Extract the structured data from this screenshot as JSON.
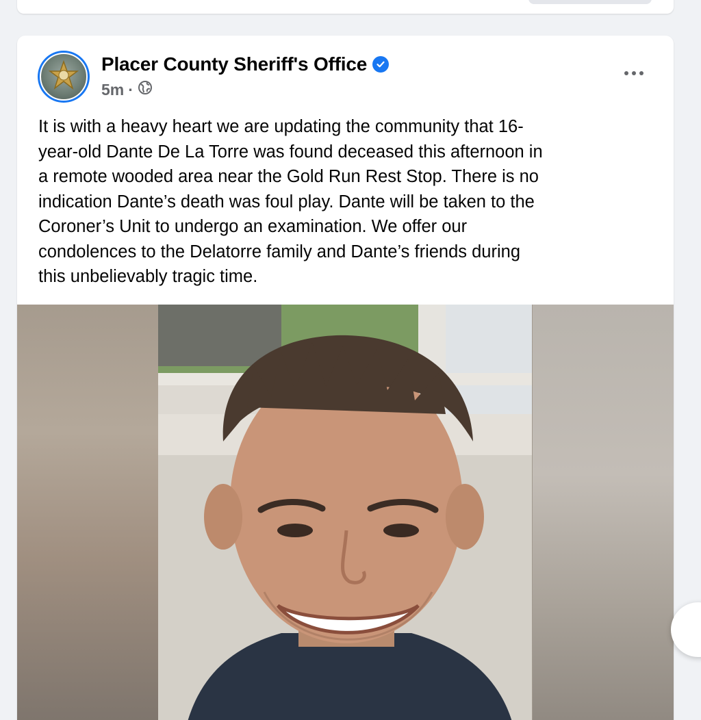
{
  "post": {
    "page_name": "Placer County Sheriff's Office",
    "timestamp": "5m",
    "separator": "·",
    "audience_icon": "globe-icon",
    "verified_icon": "verified-badge-icon",
    "more_icon": "more-options-icon",
    "text": "It is with a heavy heart we are updating the community that 16-\nyear-old Dante De La Torre was found deceased this afternoon in\na remote wooded area near the Gold Run Rest Stop. There is no\nindication Dante’s death was foul play. Dante will be taken to the\nCoroner’s Unit to undergo an examination. We offer our\ncondolences to the Delatorre family and Dante’s friends during\nthis unbelievably tragic time."
  },
  "colors": {
    "accent": "#1877f2",
    "background": "#f0f2f5",
    "card": "#ffffff",
    "secondary_text": "#65676b",
    "primary_text": "#050505"
  }
}
